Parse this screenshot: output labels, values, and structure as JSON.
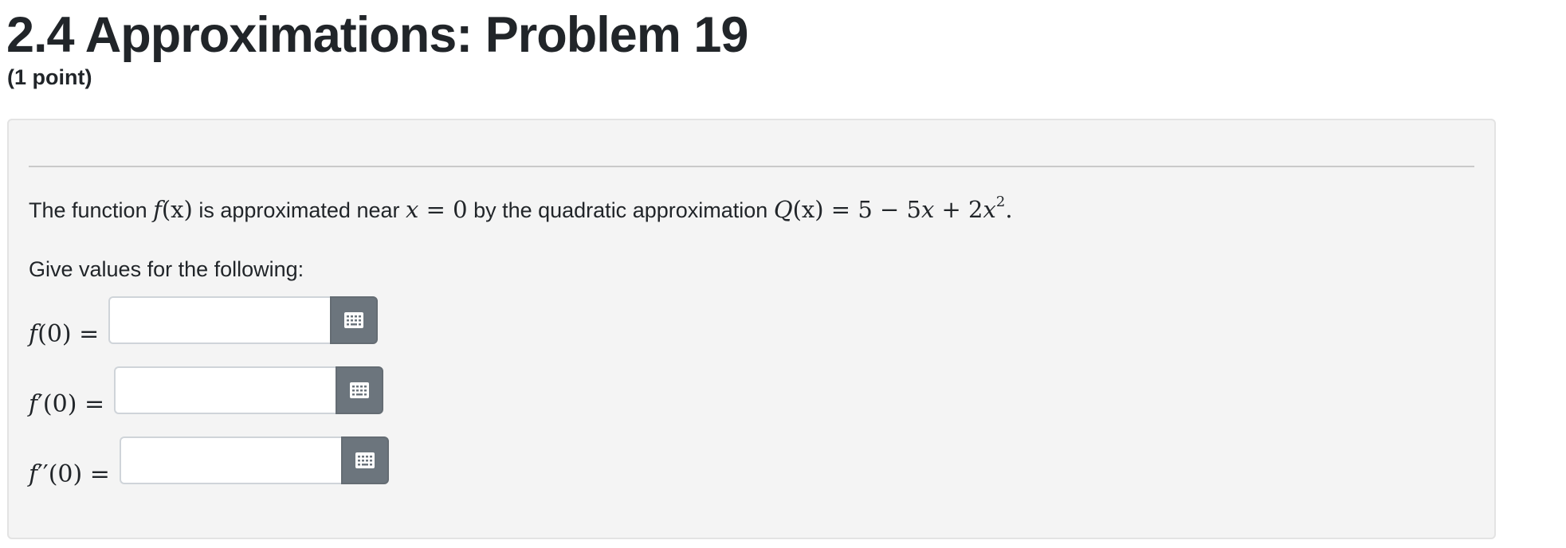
{
  "header": {
    "title": "2.4 Approximations: Problem 19",
    "points": "(1 point)"
  },
  "problem": {
    "intro_text": "The function",
    "function_name": "f",
    "function_arg": "(x)",
    "mid_text": "is approximated near",
    "point_var": "x",
    "point_eq": "= 0",
    "by_text": "by the quadratic approximation",
    "approx_name": "Q",
    "approx_arg": "(x)",
    "approx_rhs_a": "= 5 − 5",
    "approx_rhs_x": "x",
    "approx_rhs_b": " + 2",
    "approx_rhs_x2": "x",
    "approx_exponent": "2",
    "approx_end": ".",
    "instruction": "Give values for the following:"
  },
  "answers": [
    {
      "label_f": "f",
      "label_rest": "(0) =",
      "value": "",
      "keypad_icon": "keypad-icon"
    },
    {
      "label_f": "f",
      "label_rest": "′(0) =",
      "value": "",
      "keypad_icon": "keypad-icon"
    },
    {
      "label_f": "f",
      "label_rest": "′′(0) =",
      "value": "",
      "keypad_icon": "keypad-icon"
    }
  ],
  "colors": {
    "card_background": "#f4f4f4",
    "keypad_button": "#6c757d",
    "text": "#212529"
  }
}
